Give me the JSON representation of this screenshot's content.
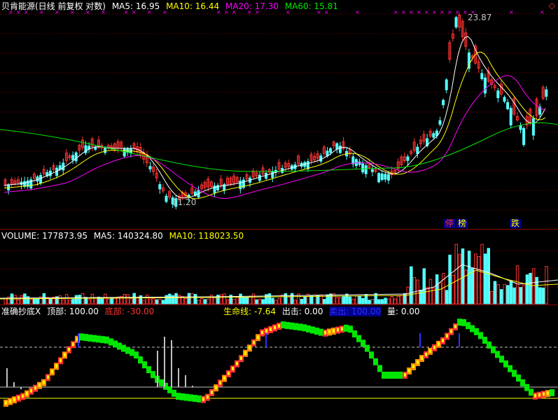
{
  "price_header": {
    "title": "贝肯能源(日线 前复权 对数)",
    "ma5": "MA5: 16.95",
    "ma10": "MA10: 16.44",
    "ma20": "MA20: 17.30",
    "ma60": "MA60: 15.81"
  },
  "price_annotations": {
    "high": "23.87",
    "low": "11.20"
  },
  "tags": {
    "t1": "停",
    "t2": "榜",
    "t3": "跌"
  },
  "volume_header": {
    "volume": "VOLUME: 177873.95",
    "ma5": "MA5: 140324.80",
    "ma10": "MA10: 118023.50"
  },
  "indicator_header": {
    "name": "准确抄底X",
    "top": "顶部: 100.00",
    "bottom": "底部: -30.00",
    "lifeline": "生命线: -7.64",
    "strike": "出击: 0.00",
    "sell": "卖出: 100.00",
    "amount": "量: 0.00"
  },
  "colors": {
    "up": "#ff3232",
    "down": "#54ffff",
    "ma5": "#ffffff",
    "ma10": "#ffff00",
    "ma20": "#ff00ff",
    "ma60": "#00e600",
    "grid": "#8b0000"
  },
  "icons": {
    "corner": "diamond-icon"
  }
}
